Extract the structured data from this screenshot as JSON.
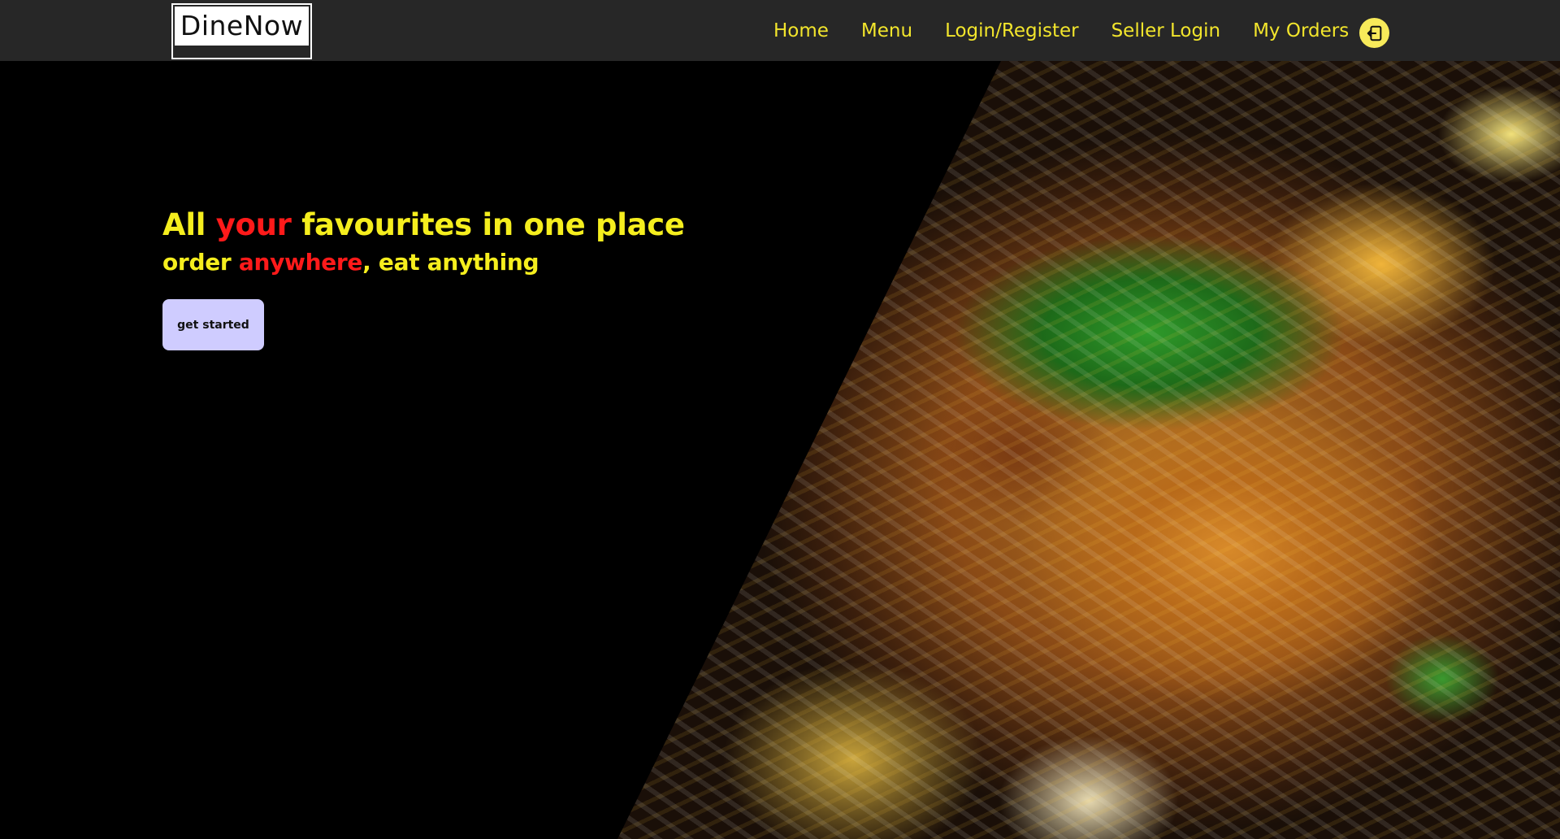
{
  "brand": {
    "logo_text": "DineNow"
  },
  "nav": {
    "items": [
      {
        "label": "Home"
      },
      {
        "label": "Menu"
      },
      {
        "label": "Login/Register"
      },
      {
        "label": "Seller Login"
      },
      {
        "label": "My Orders"
      }
    ],
    "logout_icon": "logout-icon"
  },
  "hero": {
    "headline": {
      "part1": "All ",
      "accent": "your",
      "part2": " favourites in one place"
    },
    "subline": {
      "part1": "order ",
      "accent": "anywhere",
      "part2": ", eat anything"
    },
    "cta_label": "get started",
    "image_icon": "biryani-photo"
  },
  "colors": {
    "navbar_bg": "#272727",
    "nav_text": "#f2e52c",
    "headline_yellow": "#f5ee1e",
    "headline_accent": "#ff1a1a",
    "cta_bg": "#cfccff",
    "page_bg": "#000000"
  }
}
